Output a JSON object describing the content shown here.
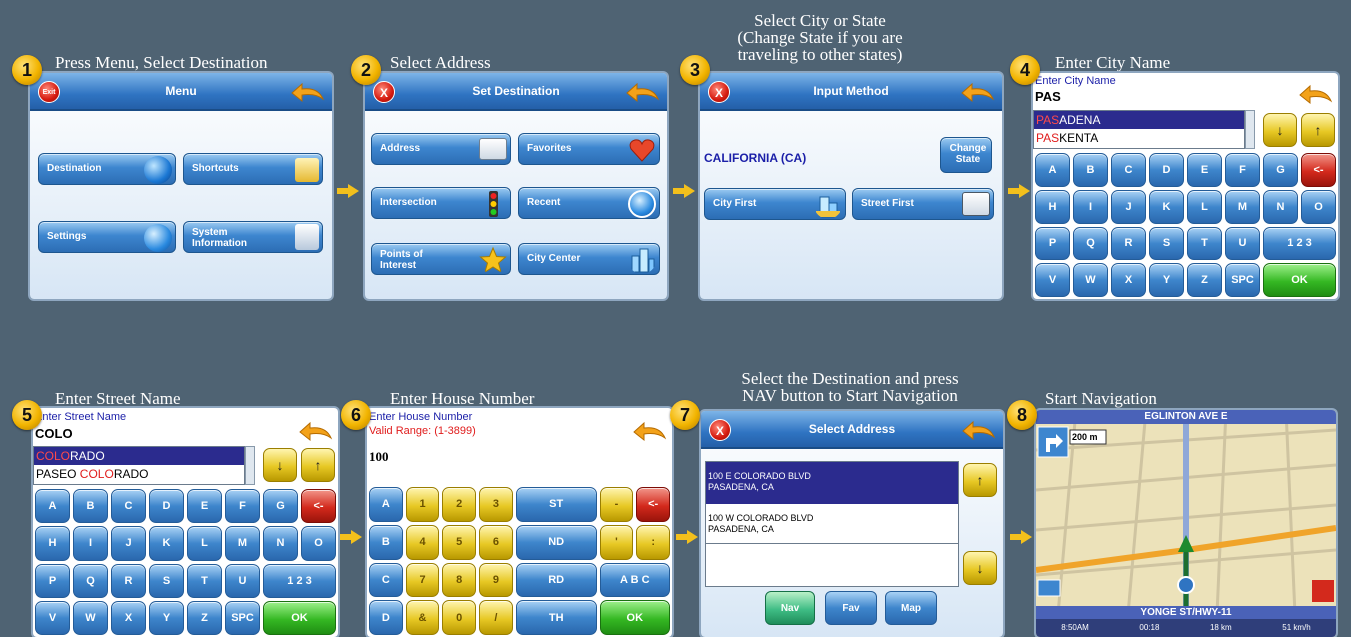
{
  "colors": {
    "background": "#4f6373",
    "badge": "#f2b400",
    "titlebar": "#2f74c2",
    "selected": "#2b2b8e",
    "highlight": "#e01c1c"
  },
  "steps": [
    {
      "num": "1",
      "title": "Press Menu, Select Destination"
    },
    {
      "num": "2",
      "title": "Select Address"
    },
    {
      "num": "3",
      "title": "Select City or State\n(Change State if you are\ntraveling to other states)"
    },
    {
      "num": "4",
      "title": "Enter City Name"
    },
    {
      "num": "5",
      "title": "Enter Street Name"
    },
    {
      "num": "6",
      "title": "Enter House Number"
    },
    {
      "num": "7",
      "title": "Select the Destination and press\nNAV button to Start Navigation"
    },
    {
      "num": "8",
      "title": "Start Navigation"
    }
  ],
  "screen1": {
    "title": "Menu",
    "close": "Exit",
    "buttons": [
      "Destination",
      "Shortcuts",
      "Settings",
      "System\nInformation"
    ],
    "icons": [
      "globe-icon",
      "shortcut-folder-icon",
      "settings-f-icon",
      "system-info-icon"
    ]
  },
  "screen2": {
    "title": "Set Destination",
    "close": "X",
    "buttons": [
      "Address",
      "Favorites",
      "Intersection",
      "Recent",
      "Points of\nInterest",
      "City Center"
    ],
    "icons": [
      "address-card-icon",
      "heart-icon",
      "traffic-light-icon",
      "recent-arrow-icon",
      "star-icon",
      "city-icon"
    ]
  },
  "screen3": {
    "title": "Input Method",
    "close": "X",
    "state": "CALIFORNIA (CA)",
    "change_state": "Change\nState",
    "buttons": [
      "City First",
      "Street First"
    ],
    "icons": [
      "city-building-icon",
      "street-sign-icon"
    ]
  },
  "screen4": {
    "header": "Enter City Name",
    "value": "PAS",
    "list": [
      {
        "match": "PAS",
        "rest": "ADENA"
      },
      {
        "match": "PAS",
        "rest": "KENTA"
      }
    ],
    "keys": [
      "A",
      "B",
      "C",
      "D",
      "E",
      "F",
      "G",
      "<-",
      "H",
      "I",
      "J",
      "K",
      "L",
      "M",
      "N",
      "O",
      "P",
      "Q",
      "R",
      "S",
      "T",
      "U",
      "1 2 3",
      "V",
      "W",
      "X",
      "Y",
      "Z",
      "SPC",
      "OK"
    ]
  },
  "screen5": {
    "header": "Enter Street Name",
    "value": "COLO",
    "list": [
      {
        "pre": "",
        "match": "COLO",
        "rest": "RADO"
      },
      {
        "pre": "PASEO ",
        "match": "COLO",
        "rest": "RADO"
      }
    ],
    "keys": [
      "A",
      "B",
      "C",
      "D",
      "E",
      "F",
      "G",
      "<-",
      "H",
      "I",
      "J",
      "K",
      "L",
      "M",
      "N",
      "O",
      "P",
      "Q",
      "R",
      "S",
      "T",
      "U",
      "1 2 3",
      "V",
      "W",
      "X",
      "Y",
      "Z",
      "SPC",
      "OK"
    ]
  },
  "screen6": {
    "header": "Enter House Number",
    "range": "Valid Range: (1-3899)",
    "value": "100",
    "keys": [
      "A",
      "1",
      "2",
      "3",
      "ST",
      "-",
      "<-",
      "B",
      "4",
      "5",
      "6",
      "ND",
      "'",
      ":",
      "C",
      "7",
      "8",
      "9",
      "RD",
      "A B C",
      "D",
      "&",
      "0",
      "/",
      "TH",
      "OK"
    ]
  },
  "screen7": {
    "title": "Select Address",
    "close": "X",
    "results": [
      {
        "line1": "100 E COLORADO BLVD",
        "line2": "PASADENA, CA"
      },
      {
        "line1": "100 W COLORADO BLVD",
        "line2": "PASADENA, CA"
      }
    ],
    "buttons": [
      "Nav",
      "Fav",
      "Map"
    ]
  },
  "screen8": {
    "street_top": "EGLINTON AVE E",
    "distance": "200 m",
    "street_bottom": "YONGE ST/HWY-11",
    "status": [
      "8:50AM",
      "00:18",
      "18 km",
      "51 km/h"
    ]
  }
}
